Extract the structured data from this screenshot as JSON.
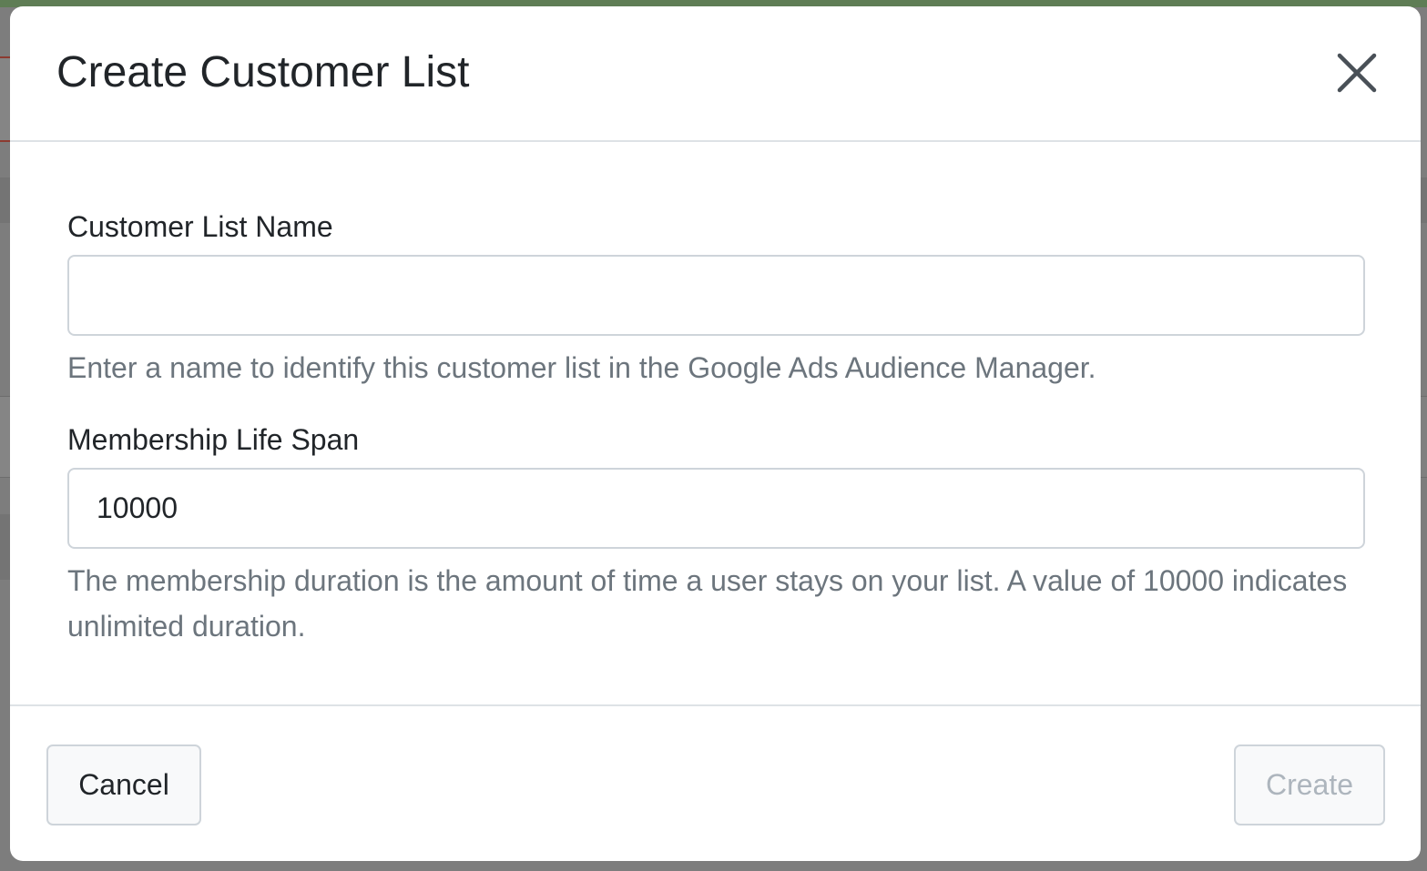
{
  "modal": {
    "title": "Create Customer List",
    "close_icon": "close-icon"
  },
  "form": {
    "name_field": {
      "label": "Customer List Name",
      "value": "",
      "placeholder": "",
      "help": "Enter a name to identify this customer list in the Google Ads Audience Manager."
    },
    "lifespan_field": {
      "label": "Membership Life Span",
      "value": "10000",
      "help": "The membership duration is the amount of time a user stays on your list. A value of 10000 indicates unlimited duration."
    }
  },
  "footer": {
    "cancel_label": "Cancel",
    "create_label": "Create",
    "create_disabled": true
  },
  "colors": {
    "title": "#212529",
    "help_text": "#6c757d",
    "border": "#ced4da",
    "divider": "#dee2e6",
    "disabled_text": "#adb5bd",
    "backdrop": "#7d7d7d"
  }
}
